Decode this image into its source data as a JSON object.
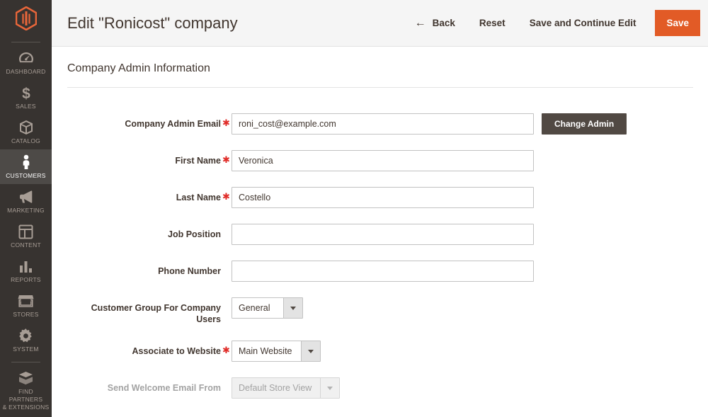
{
  "sidebar": {
    "logo_icon": "magento-logo-icon",
    "items": [
      {
        "label": "Dashboard",
        "icon": "dashboard-icon",
        "active": false
      },
      {
        "label": "Sales",
        "icon": "dollar-icon",
        "active": false
      },
      {
        "label": "Catalog",
        "icon": "box-icon",
        "active": false
      },
      {
        "label": "Customers",
        "icon": "person-icon",
        "active": true
      },
      {
        "label": "Marketing",
        "icon": "megaphone-icon",
        "active": false
      },
      {
        "label": "Content",
        "icon": "layout-icon",
        "active": false
      },
      {
        "label": "Reports",
        "icon": "bar-chart-icon",
        "active": false
      },
      {
        "label": "Stores",
        "icon": "storefront-icon",
        "active": false
      },
      {
        "label": "System",
        "icon": "gear-icon",
        "active": false
      },
      {
        "label": "Find Partners\n& Extensions",
        "icon": "package-icon",
        "active": false
      }
    ]
  },
  "header": {
    "title": "Edit \"Ronicost\" company",
    "back_label": "Back",
    "back_icon": "arrow-left-icon",
    "reset_label": "Reset",
    "save_continue_label": "Save and Continue Edit",
    "save_label": "Save",
    "accent_color": "#e25b26"
  },
  "content": {
    "section_title": "Company Admin Information",
    "fields": {
      "company_admin_email": {
        "label": "Company Admin Email",
        "required": true,
        "value": "roni_cost@example.com",
        "placeholder": "",
        "button_label": "Change Admin"
      },
      "first_name": {
        "label": "First Name",
        "required": true,
        "value": "Veronica",
        "placeholder": ""
      },
      "last_name": {
        "label": "Last Name",
        "required": true,
        "value": "Costello",
        "placeholder": ""
      },
      "job_position": {
        "label": "Job Position",
        "required": false,
        "value": "",
        "placeholder": ""
      },
      "phone_number": {
        "label": "Phone Number",
        "required": false,
        "value": "",
        "placeholder": ""
      },
      "customer_group": {
        "label": "Customer Group For Company Users",
        "required": false,
        "value": "General"
      },
      "associate_website": {
        "label": "Associate to Website",
        "required": true,
        "value": "Main Website"
      },
      "welcome_email_from": {
        "label": "Send Welcome Email From",
        "required": false,
        "value": "Default Store View",
        "disabled": true
      }
    }
  }
}
